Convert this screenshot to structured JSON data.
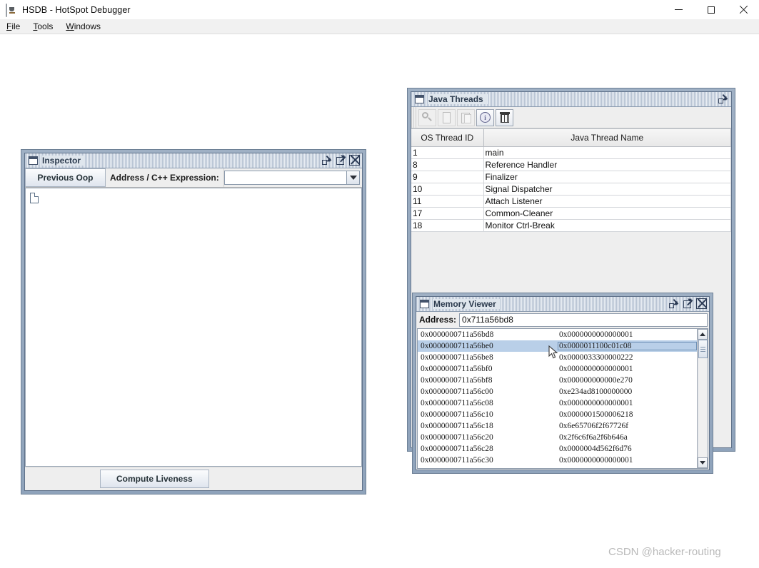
{
  "window": {
    "title": "HSDB - HotSpot Debugger",
    "app_icon": "java-cup-icon",
    "controls": {
      "minimize": "minimize-button",
      "maximize": "maximize-button",
      "close": "close-button"
    }
  },
  "menubar": {
    "items": [
      {
        "label": "File",
        "mnemonic": "F"
      },
      {
        "label": "Tools",
        "mnemonic": "T"
      },
      {
        "label": "Windows",
        "mnemonic": "W"
      }
    ]
  },
  "inspector": {
    "title": "Inspector",
    "previous_oop_label": "Previous Oop",
    "address_label": "Address / C++ Expression:",
    "address_value": "",
    "address_placeholder": "",
    "tree_root_icon": "document-icon",
    "compute_liveness_label": "Compute Liveness",
    "frame_buttons": [
      "iconify-icon",
      "maximize-icon",
      "close-icon"
    ]
  },
  "java_threads": {
    "title": "Java Threads",
    "toolbar": [
      {
        "name": "inspect-thread-icon",
        "icon": "magnifier-icon",
        "enabled": false
      },
      {
        "name": "stack-memory-icon",
        "icon": "document-icon",
        "enabled": false
      },
      {
        "name": "stack-trace-icon",
        "icon": "documents-icon",
        "enabled": false
      },
      {
        "name": "thread-info-icon",
        "icon": "info-circle-icon",
        "enabled": true
      },
      {
        "name": "monitor-cache-dump-icon",
        "icon": "trash-icon",
        "enabled": true
      }
    ],
    "columns": [
      "OS Thread ID",
      "Java Thread Name"
    ],
    "rows": [
      {
        "id": "1",
        "name": "main"
      },
      {
        "id": "8",
        "name": "Reference Handler"
      },
      {
        "id": "9",
        "name": "Finalizer"
      },
      {
        "id": "10",
        "name": "Signal Dispatcher"
      },
      {
        "id": "11",
        "name": "Attach Listener"
      },
      {
        "id": "17",
        "name": "Common-Cleaner"
      },
      {
        "id": "18",
        "name": "Monitor Ctrl-Break"
      }
    ],
    "frame_buttons": [
      "iconify-icon"
    ]
  },
  "memory_viewer": {
    "title": "Memory Viewer",
    "address_label": "Address:",
    "address_value": "0x711a56bd8",
    "frame_buttons": [
      "iconify-icon",
      "maximize-icon",
      "close-icon"
    ],
    "selected_row_index": 1,
    "rows": [
      {
        "address": "0x0000000711a56bd8",
        "value": "0x0000000000000001"
      },
      {
        "address": "0x0000000711a56be0",
        "value": "0x0000011100c01c08"
      },
      {
        "address": "0x0000000711a56be8",
        "value": "0x0000033300000222"
      },
      {
        "address": "0x0000000711a56bf0",
        "value": "0x0000000000000001"
      },
      {
        "address": "0x0000000711a56bf8",
        "value": "0x000000000000e270"
      },
      {
        "address": "0x0000000711a56c00",
        "value": "0xe234ad8100000000"
      },
      {
        "address": "0x0000000711a56c08",
        "value": "0x0000000000000001"
      },
      {
        "address": "0x0000000711a56c10",
        "value": "0x0000001500006218"
      },
      {
        "address": "0x0000000711a56c18",
        "value": "0x6e65706f2f67726f"
      },
      {
        "address": "0x0000000711a56c20",
        "value": "0x2f6c6f6a2f6b646a"
      },
      {
        "address": "0x0000000711a56c28",
        "value": "0x0000004d562f6d76"
      },
      {
        "address": "0x0000000711a56c30",
        "value": "0x0000000000000001"
      }
    ],
    "scrollbar": {
      "up": "scroll-up-arrow",
      "down": "scroll-down-arrow",
      "thumb": "scroll-thumb"
    }
  },
  "watermark": {
    "text": "CSDN @hacker-routing"
  },
  "colors": {
    "selection": "#b9cfe8",
    "frame_border": "#6d8096",
    "titlebar_gradient_from": "#9fb0c4",
    "panel_bg": "#eeeeee",
    "text": "#111111",
    "watermark": "#b9b9b9"
  }
}
